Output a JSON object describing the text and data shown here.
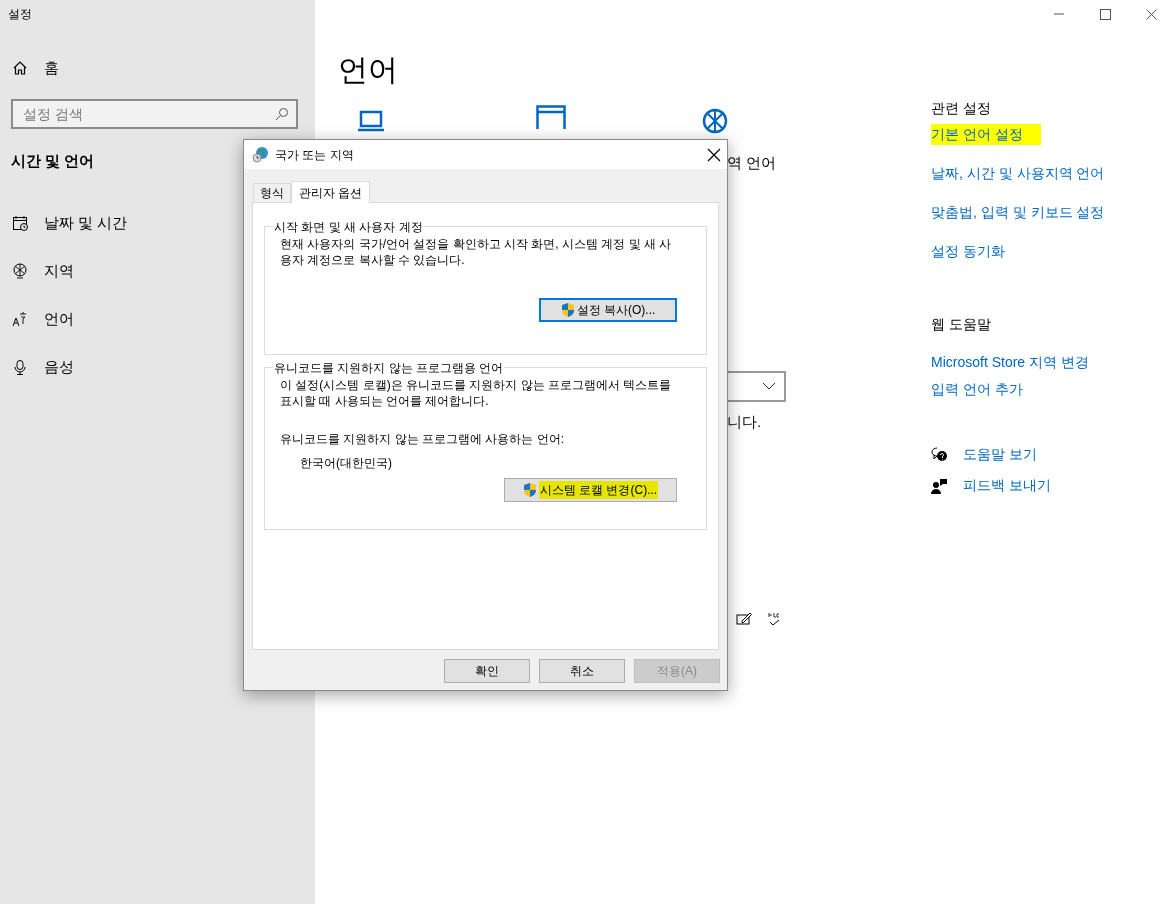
{
  "app_title": "설정",
  "sidebar": {
    "home": "홈",
    "search": {
      "placeholder": "설정 검색"
    },
    "section": "시간 및 언어",
    "items": [
      {
        "kind": "date",
        "label": "날짜 및 시간"
      },
      {
        "kind": "region",
        "label": "지역"
      },
      {
        "kind": "language",
        "label": "언어"
      },
      {
        "kind": "speech",
        "label": "음성"
      }
    ]
  },
  "main": {
    "title": "언어",
    "fragments": [
      "역 언어",
      "니다."
    ]
  },
  "dialog": {
    "title": "국가 또는 지역",
    "tabs": [
      {
        "label": "형식",
        "selected": false
      },
      {
        "label": "관리자 옵션",
        "selected": true
      }
    ],
    "groups": [
      {
        "legend": "시작 화면 및 새 사용자 계정",
        "text": "현재 사용자의 국가/언어 설정을 확인하고 시작 화면, 시스템 계정 및 새 사용자 계정으로 복사할 수 있습니다.",
        "button": {
          "label": "설정 복사(O)...",
          "default": true,
          "highlighted": false
        }
      },
      {
        "legend": "유니코드를 지원하지 않는 프로그램용 언어",
        "text": "이 설정(시스템 로캘)은 유니코드를 지원하지 않는 프로그램에서 텍스트를 표시할 때 사용되는 언어를 제어합니다.",
        "sublabel": "유니코드를 지원하지 않는 프로그램에 사용하는 언어:",
        "value": "한국어(대한민국)",
        "button": {
          "label": "시스템 로캘 변경(C)...",
          "default": false,
          "highlighted": true
        }
      }
    ],
    "buttons": [
      {
        "label": "확인",
        "disabled": false
      },
      {
        "label": "취소",
        "disabled": false
      },
      {
        "label": "적용(A)",
        "disabled": true
      }
    ]
  },
  "related": {
    "heading": "관련 설정",
    "links": [
      {
        "label": "기본 언어 설정",
        "highlighted": true
      },
      {
        "label": "날짜, 시간 및 사용지역 언어",
        "highlighted": false
      },
      {
        "label": "맞춤법, 입력 및 키보드 설정",
        "highlighted": false
      },
      {
        "label": "설정 동기화",
        "highlighted": false
      }
    ]
  },
  "web_help": {
    "heading": "웹 도움말",
    "links": [
      {
        "label": "Microsoft Store 지역 변경"
      },
      {
        "label": "입력 언어 추가"
      }
    ]
  },
  "support": [
    {
      "kind": "help",
      "label": "도움말 보기"
    },
    {
      "kind": "feedback",
      "label": "피드백 보내기"
    }
  ]
}
